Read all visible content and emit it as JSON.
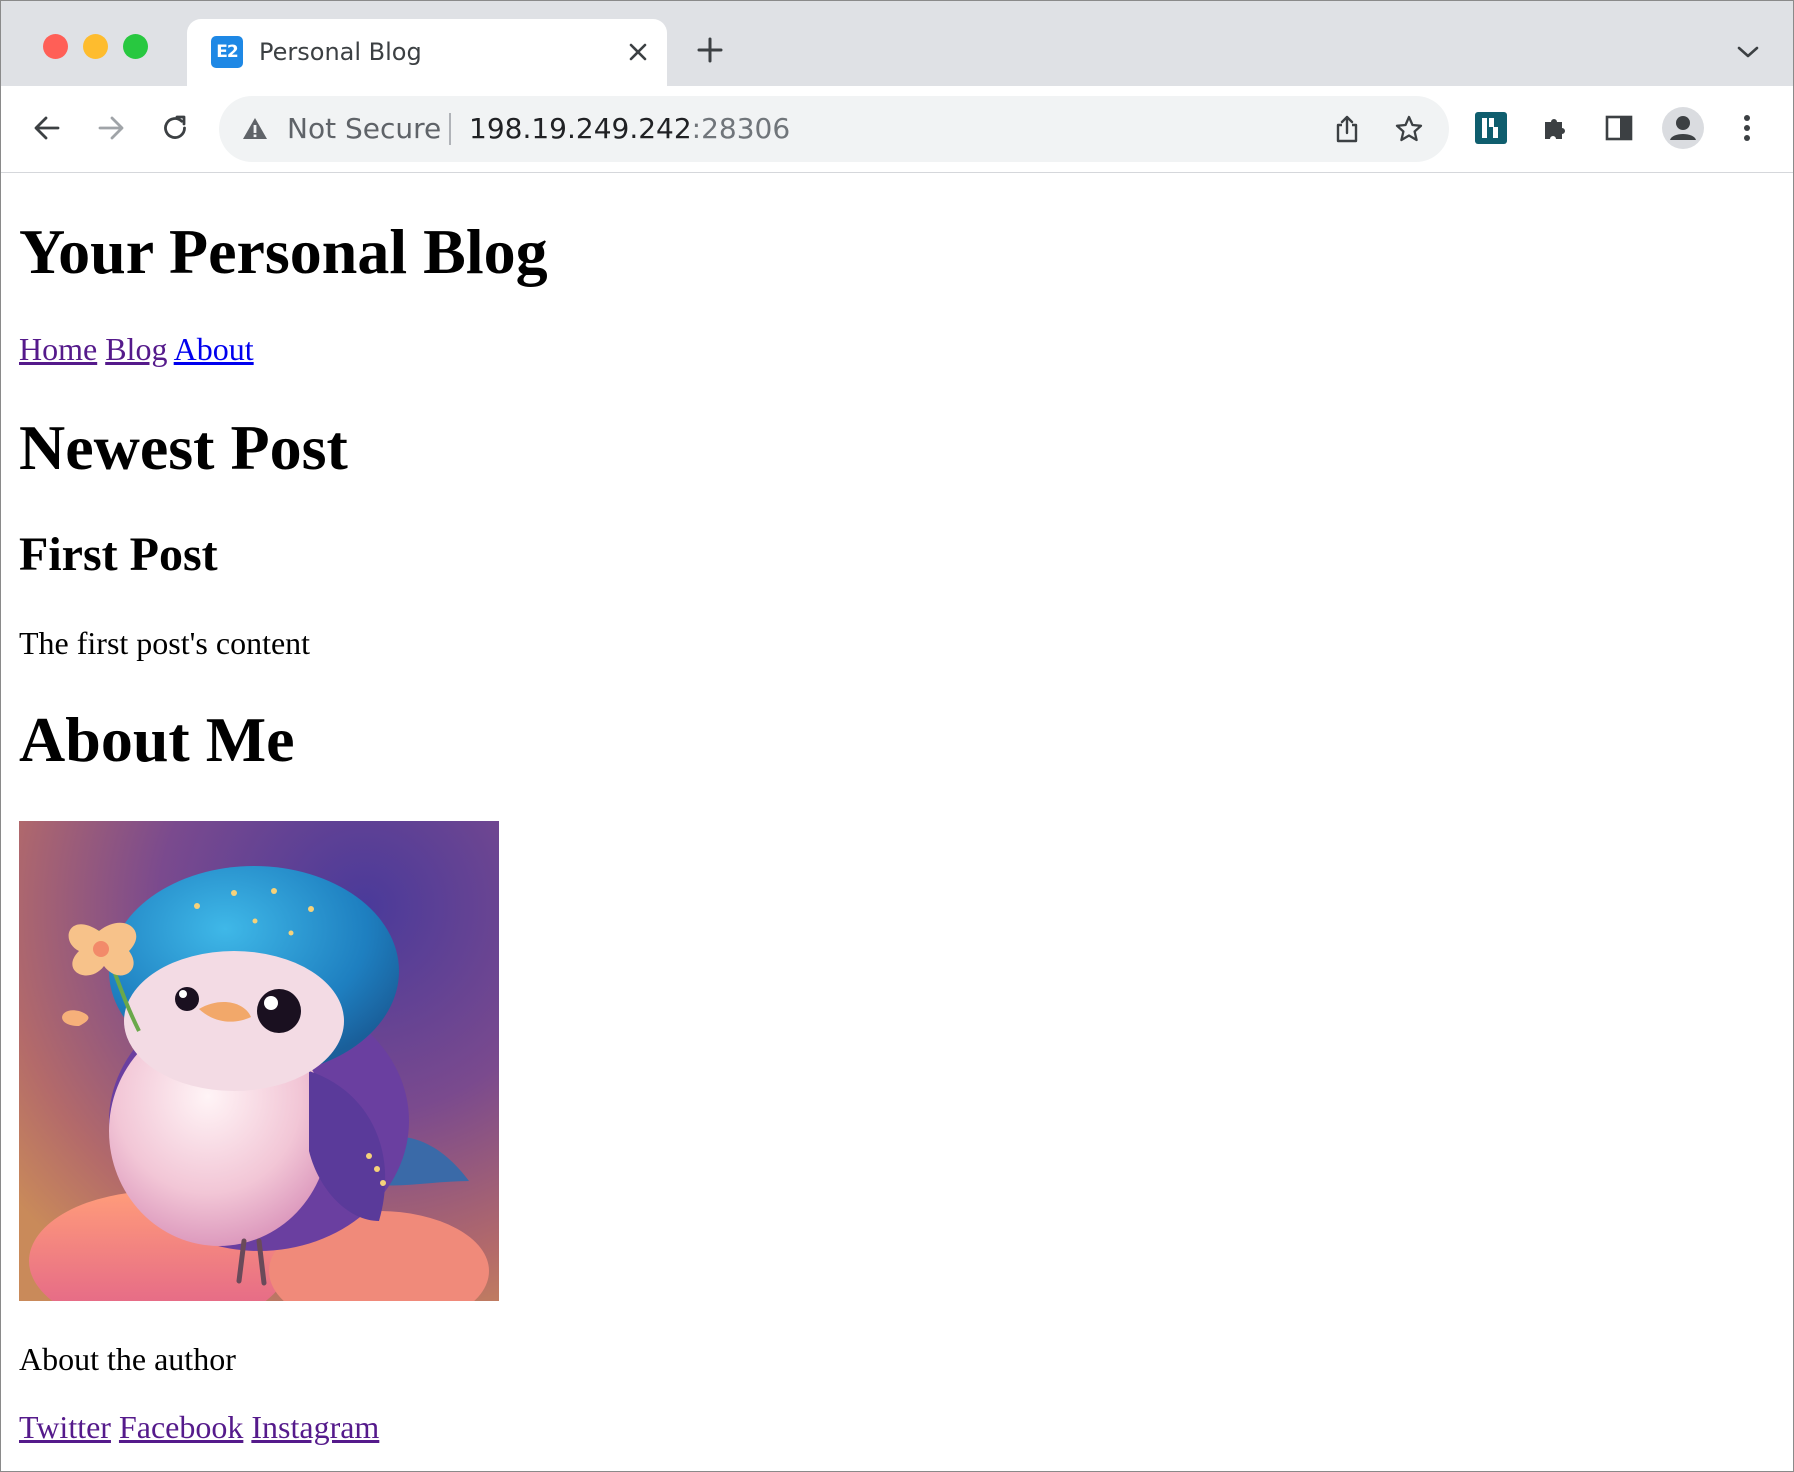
{
  "browser": {
    "tab": {
      "favicon_text": "E2",
      "title": "Personal Blog"
    },
    "omnibox": {
      "security_label": "Not Secure",
      "host": "198.19.249.242",
      "port": ":28306"
    },
    "icons": [
      "back-icon",
      "forward-icon",
      "reload-icon",
      "share-icon",
      "bookmark-star-icon",
      "extension-teal-icon",
      "puzzle-extensions-icon",
      "side-panel-icon",
      "profile-avatar-icon",
      "more-menu-icon"
    ]
  },
  "page": {
    "site_title": "Your Personal Blog",
    "nav": [
      {
        "label": "Home",
        "visited": true
      },
      {
        "label": "Blog",
        "visited": true
      },
      {
        "label": "About",
        "visited": false
      }
    ],
    "newest_heading": "Newest Post",
    "post": {
      "title": "First Post",
      "content": "The first post's content"
    },
    "about_heading": "About Me",
    "about_text": "About the author",
    "social": [
      {
        "label": "Twitter"
      },
      {
        "label": "Facebook"
      },
      {
        "label": "Instagram"
      }
    ]
  },
  "colors": {
    "link_visited": "#551a8b",
    "link_unvisited": "#0000ee",
    "favicon": "#1e88e5",
    "extension": "#0f5e6e"
  }
}
